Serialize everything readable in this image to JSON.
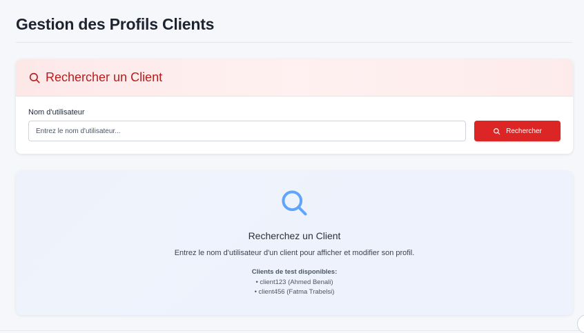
{
  "page": {
    "title": "Gestion des Profils Clients"
  },
  "search_card": {
    "header_title": "Rechercher un Client",
    "header_icon": "search-icon",
    "field_label": "Nom d'utilisateur",
    "input_value": "",
    "input_placeholder": "Entrez le nom d'utilisateur...",
    "button_label": "Rechercher",
    "button_icon": "search-icon"
  },
  "empty_state": {
    "icon": "search-icon",
    "title": "Recherchez un Client",
    "description": "Entrez le nom d'utilisateur d'un client pour afficher et modifier son profil.",
    "test_clients_heading": "Clients de test disponibles:",
    "test_clients": [
      "• client123 (Ahmed Benali)",
      "• client456 (Fatma Trabelsi)"
    ]
  },
  "colors": {
    "accent": "#dc2626",
    "header_text": "#b91c1c",
    "empty_icon": "#60a5fa"
  }
}
